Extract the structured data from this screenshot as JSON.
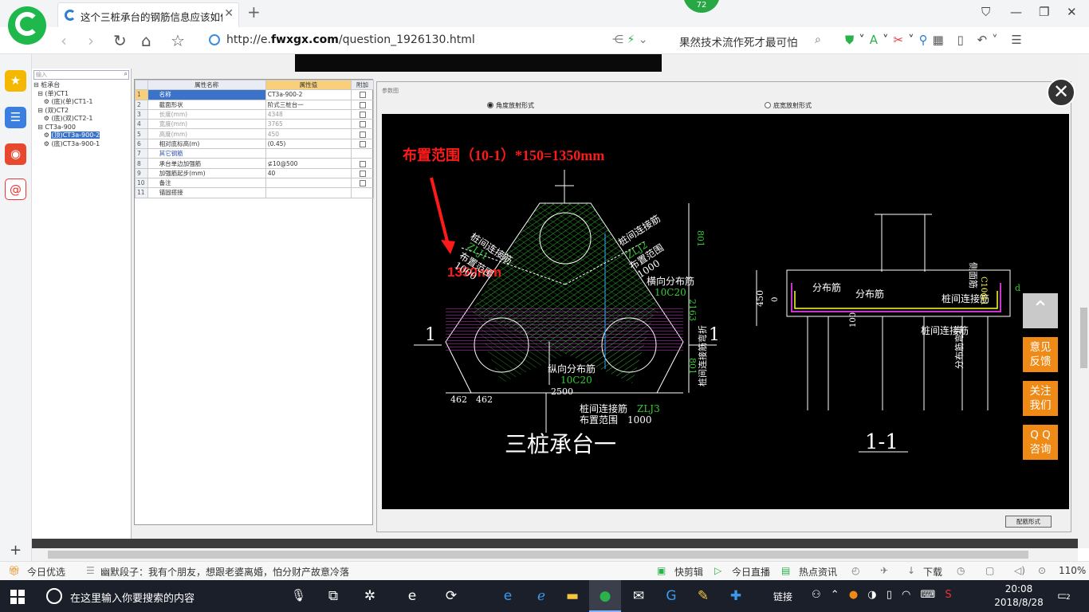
{
  "browser": {
    "tab_title": "这个三桩承台的钢筋信息应该如何...",
    "score": "72",
    "url_scheme": "http://e.",
    "url_host": "fwxgx.com",
    "url_path": "/question_1926130.html",
    "search_text": "果然技术流作死才最可怕"
  },
  "tree": {
    "search_placeholder": "输入",
    "items": [
      "桩承台",
      "(单)CT1",
      "(底)(单)CT1-1",
      "(双)CT2",
      "(底)(双)CT2-1",
      "CT3a-900",
      "(顶)CT3a-900-2",
      "(底)CT3a-900-1"
    ]
  },
  "props": {
    "headers": [
      "属性名称",
      "属性值",
      "附加"
    ],
    "rows": [
      {
        "n": "1",
        "name": "名称",
        "value": "CT3a-900-2"
      },
      {
        "n": "2",
        "name": "截面形状",
        "value": "阶式三桩台一"
      },
      {
        "n": "3",
        "name": "长度(mm)",
        "value": "4348"
      },
      {
        "n": "4",
        "name": "宽度(mm)",
        "value": "3765"
      },
      {
        "n": "5",
        "name": "高度(mm)",
        "value": "450"
      },
      {
        "n": "6",
        "name": "相对底标高(m)",
        "value": "(0.45)"
      },
      {
        "n": "7",
        "name": "其它钢筋",
        "value": ""
      },
      {
        "n": "8",
        "name": "承台单边加强筋",
        "value": "⊈10@500"
      },
      {
        "n": "9",
        "name": "加强筋起步(mm)",
        "value": "40"
      },
      {
        "n": "10",
        "name": "备注",
        "value": ""
      },
      {
        "n": "11",
        "name": "锚固搭接",
        "value": ""
      }
    ]
  },
  "dialog": {
    "header": "参数图",
    "radio_angle": "角度放射形式",
    "radio_width": "底宽放射形式",
    "config_button": "配筋形式"
  },
  "drawing": {
    "annotation": "布置范围（10-1）*150=1350mm",
    "annotation_short": "1350mm",
    "title_plan": "三桩承台一",
    "title_section": "1-1",
    "section_mark": "1",
    "labels": {
      "zlj1_a": "桩间连接筋",
      "zlj1_b": "ZLJ1",
      "zlj1_c": "布置范围",
      "zlj1_d": "1000",
      "zlj2_a": "桩间连接筋",
      "zlj2_b": "ZLJ2",
      "zlj2_c": "布置范围",
      "zlj2_d": "1000",
      "hfb_a": "横向分布筋",
      "hfb_b": "10C20",
      "zfb_a": "纵向分布筋",
      "zfb_b": "10C20",
      "zlj3_a": "桩间连接筋",
      "zlj3_b": "ZLJ3",
      "zlj3_c": "布置范围",
      "zlj3_d": "1000",
      "dim_801_top": "801",
      "dim_2163": "2163",
      "dim_801_bot": "801",
      "dim_462_a": "462",
      "dim_462_b": "462",
      "dim_2500": "2500",
      "sec_fbj_1": "分布筋",
      "sec_fbj_2": "分布筋",
      "sec_zljj": "桩间连接筋",
      "sec_zljj_2": "桩间连接筋",
      "sec_zljj_wz": "桩间连接筋弯折",
      "sec_fbj_wz": "分布筋弯折",
      "sec_cmj": "侧面筋",
      "sec_cmj_val": "C10@1",
      "sec_450": "450",
      "sec_0": "0",
      "sec_100": "100",
      "sec_d": "d"
    }
  },
  "floating": {
    "feedback": [
      "意见",
      "反馈"
    ],
    "follow": [
      "关注",
      "我们"
    ],
    "qq": [
      "Q Q",
      "咨询"
    ]
  },
  "status": {
    "today": "今日优选",
    "joke": "幽默段子：我有个朋友，想跟老婆离婚，怕分财产故意冷落",
    "clip": "快剪辑",
    "live": "今日直播",
    "news": "热点资讯",
    "download": "下载",
    "zoom": "110%"
  },
  "taskbar": {
    "search": "在这里输入你要搜索的内容",
    "link": "链接",
    "time": "20:08",
    "date": "2018/8/28",
    "notifications": "2"
  }
}
